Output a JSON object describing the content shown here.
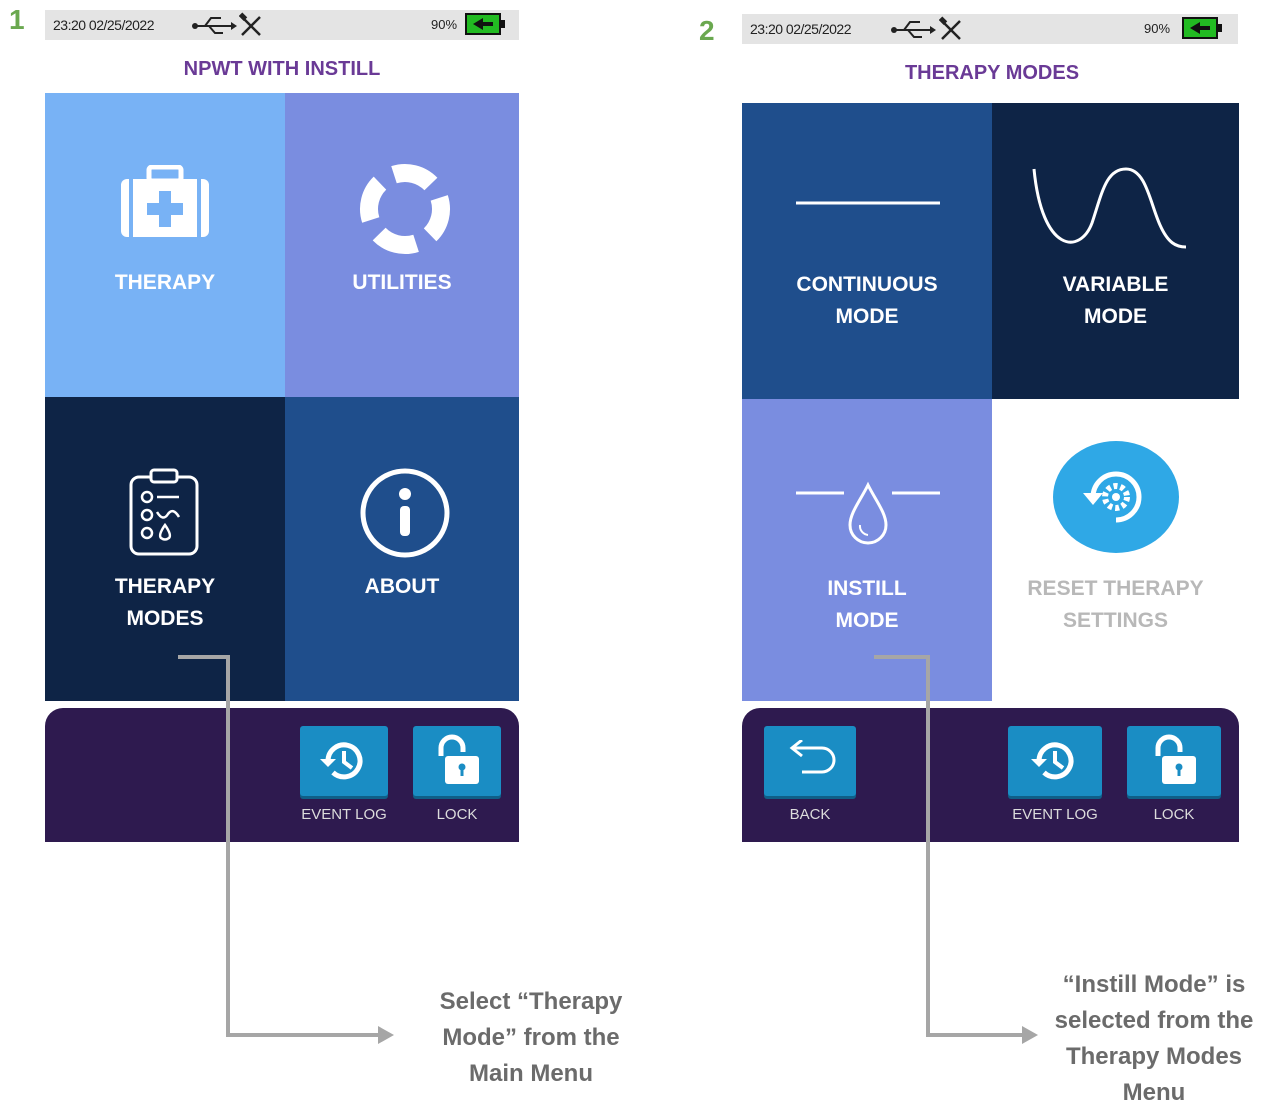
{
  "panel1": {
    "step": "1",
    "status": {
      "time": "23:20 02/25/2022",
      "battery": "90%"
    },
    "title": "NPWT WITH INSTILL",
    "tiles": {
      "therapy": {
        "label": "THERAPY",
        "icon": "first-aid-kit-icon"
      },
      "utilities": {
        "label": "UTILITIES",
        "icon": "lifebuoy-icon"
      },
      "therapy_modes": {
        "line1": "THERAPY",
        "line2": "MODES",
        "icon": "clipboard-modes-icon"
      },
      "about": {
        "label": "ABOUT",
        "icon": "info-icon"
      }
    },
    "footer": {
      "event_log": "EVENT LOG",
      "lock": "LOCK"
    },
    "callout": {
      "line1": "Select “Therapy",
      "line2": "Mode” from the",
      "line3": "Main Menu"
    }
  },
  "panel2": {
    "step": "2",
    "status": {
      "time": "23:20 02/25/2022",
      "battery": "90%"
    },
    "title": "THERAPY MODES",
    "tiles": {
      "continuous": {
        "line1": "CONTINUOUS",
        "line2": "MODE",
        "icon": "flat-line-icon"
      },
      "variable": {
        "line1": "VARIABLE",
        "line2": "MODE",
        "icon": "wave-icon"
      },
      "instill": {
        "line1": "INSTILL",
        "line2": "MODE",
        "icon": "droplet-icon"
      },
      "reset": {
        "line1": "RESET THERAPY",
        "line2": "SETTINGS",
        "icon": "reset-gear-icon"
      }
    },
    "footer": {
      "back": "BACK",
      "event_log": "EVENT LOG",
      "lock": "LOCK"
    },
    "callout": {
      "line1": "“Instill Mode” is",
      "line2": "selected from the",
      "line3": "Therapy Modes",
      "line4": "Menu"
    }
  },
  "colors": {
    "light_blue": "#78b2f5",
    "periwinkle": "#7a8de0",
    "navy": "#0e2446",
    "mid_blue": "#1f4e8c",
    "footer": "#2e1a4f",
    "title_purple": "#6a3a96",
    "step_green": "#6aa84f",
    "button_blue": "#1a8dc4"
  }
}
